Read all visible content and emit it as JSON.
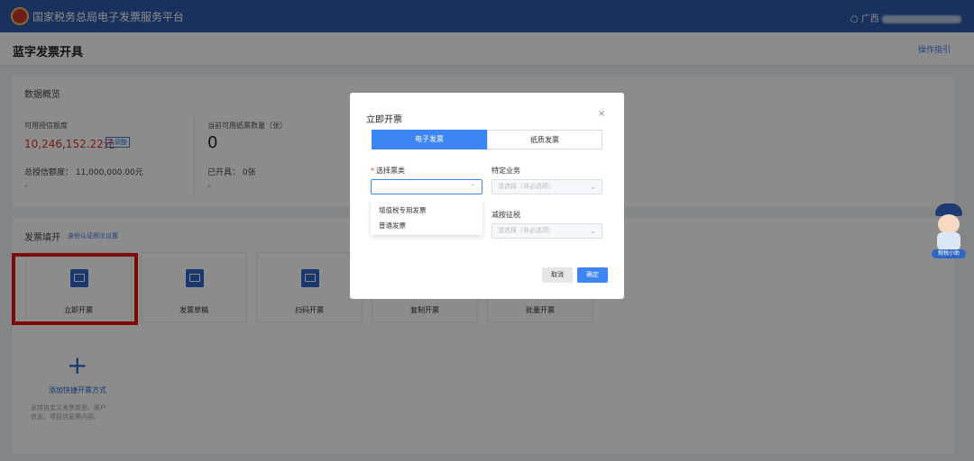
{
  "app": {
    "title": "国家税务总局电子发票服务平台",
    "user_prefix": "广西"
  },
  "page": {
    "title": "蓝字发票开具",
    "guide_link": "操作指引"
  },
  "overview": {
    "title": "数据概览",
    "credit_label": "可用授信额度",
    "credit_value": "10,246,152.22元",
    "credit_tag": "去调整",
    "paper_label": "当前可用纸票数量（张）",
    "paper_value": "0",
    "total_credit": "总授信额度：  11,000,000.00元",
    "total_credit_sub": "-",
    "issued": "已开具：  0张",
    "issued_sub": "-"
  },
  "issue_section": {
    "title": "发票填开",
    "link": "身份认证频次设置",
    "tiles": [
      "立即开票",
      "发票草稿",
      "扫码开票",
      "复制开票",
      "批量开票"
    ],
    "add_title": "添加快捷开票方式",
    "add_desc": "支持自定义发票类型、客户信息、项目信息等内容。"
  },
  "modal": {
    "title": "立即开票",
    "close": "×",
    "tabs": [
      "电子发票",
      "纸质发票"
    ],
    "field_invoice_type": {
      "required": "*",
      "label": "选择票类",
      "value": ""
    },
    "field_specific": {
      "label": "特定业务",
      "placeholder": "请选择（非必选项）"
    },
    "field_reduce": {
      "label": "减按征税",
      "placeholder": "请选择（非必选项）"
    },
    "dropdown_options": [
      "增值税专用发票",
      "普通发票"
    ],
    "cancel": "取消",
    "confirm": "确定"
  },
  "mascot": {
    "label": "税税小助"
  },
  "colors": {
    "header": "#2f5aa8",
    "primary": "#3d84f5",
    "danger": "#d9332b",
    "highlight": "#e8120f"
  }
}
